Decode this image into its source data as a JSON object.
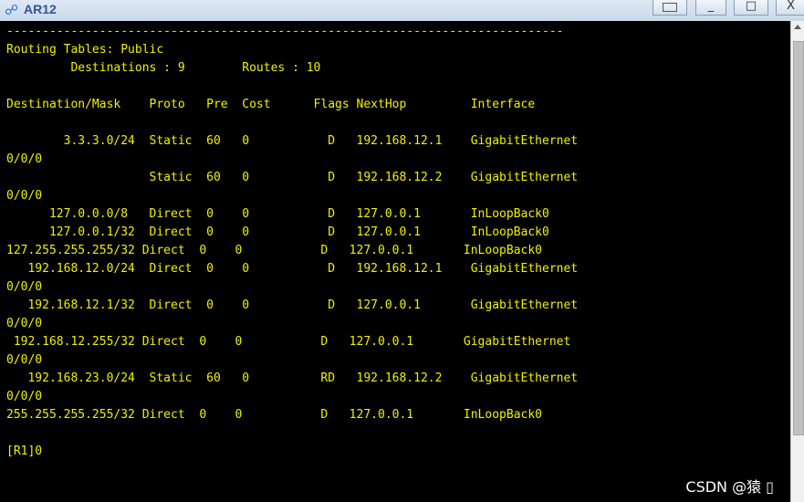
{
  "window": {
    "title": "AR12",
    "icon": "router-icon",
    "buttons": {
      "minimize": "_",
      "maximize": "□",
      "close": "X"
    }
  },
  "terminal": {
    "separator": "------------------------------------------------------------------------------",
    "header_line": "Routing Tables: Public",
    "summary_line": "         Destinations : 9        Routes : 10",
    "columns_line": "Destination/Mask    Proto   Pre  Cost      Flags NextHop         Interface",
    "rows": [
      "        3.3.3.0/24  Static  60   0           D   192.168.12.1    GigabitEthernet",
      "0/0/0",
      "                    Static  60   0           D   192.168.12.2    GigabitEthernet",
      "0/0/0",
      "      127.0.0.0/8   Direct  0    0           D   127.0.0.1       InLoopBack0",
      "      127.0.0.1/32  Direct  0    0           D   127.0.0.1       InLoopBack0",
      "127.255.255.255/32 Direct  0    0           D   127.0.0.1       InLoopBack0",
      "   192.168.12.0/24  Direct  0    0           D   192.168.12.1    GigabitEthernet",
      "0/0/0",
      "   192.168.12.1/32  Direct  0    0           D   127.0.0.1       GigabitEthernet",
      "0/0/0",
      " 192.168.12.255/32 Direct  0    0           D   127.0.0.1       GigabitEthernet",
      "0/0/0",
      "   192.168.23.0/24  Static  60   0          RD   192.168.12.2    GigabitEthernet",
      "0/0/0",
      "255.255.255.255/32 Direct  0    0           D   127.0.0.1       InLoopBack0"
    ],
    "prompt": "[R1]0"
  },
  "watermark": "CSDN @猿 ▯",
  "colors": {
    "background": "#000000",
    "text": "#f0f000"
  }
}
